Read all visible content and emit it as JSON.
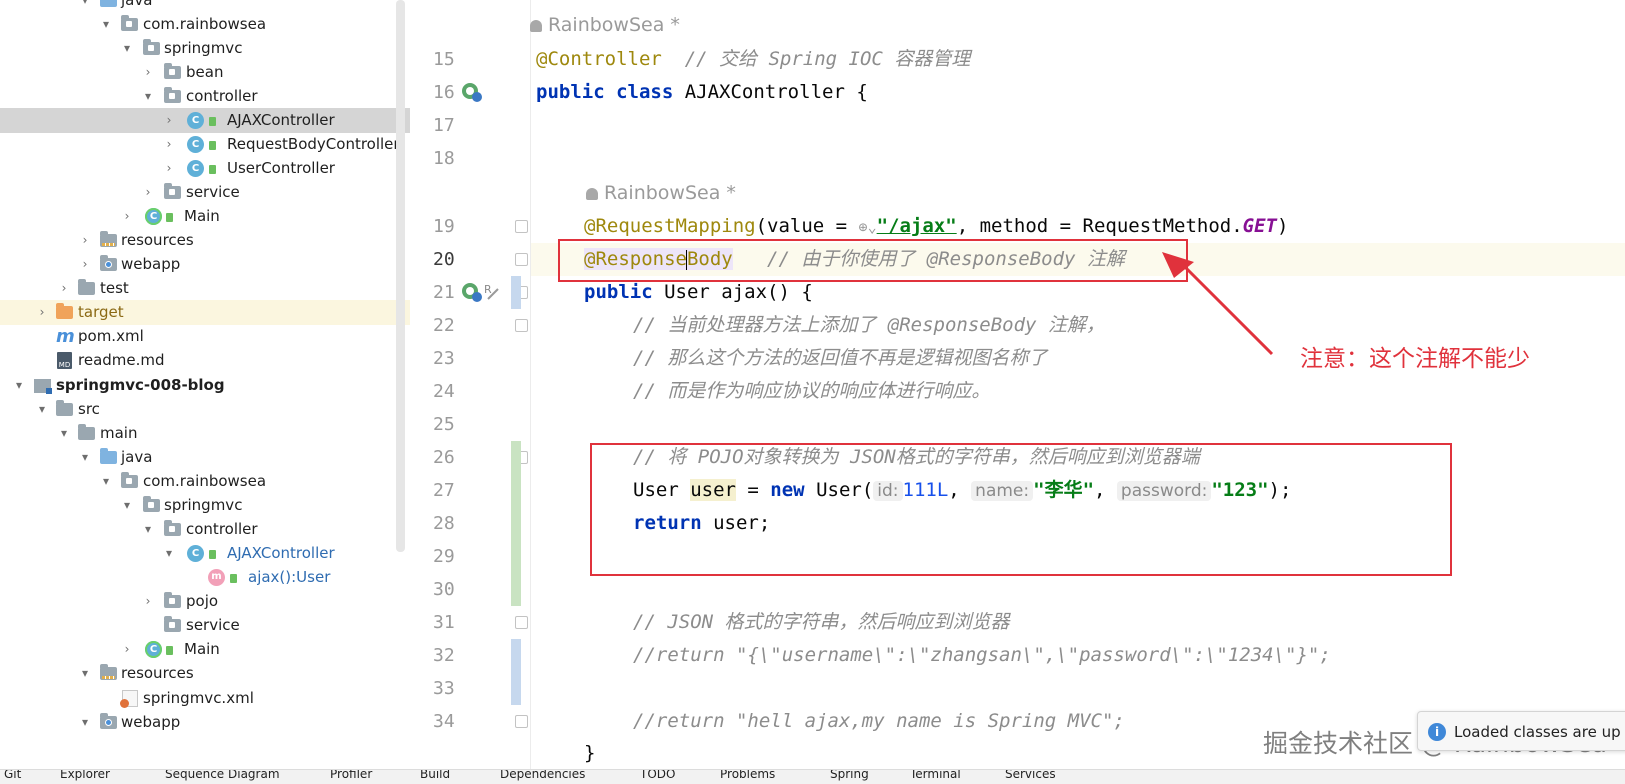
{
  "tree": {
    "items": [
      {
        "label": "java"
      },
      {
        "label": "com.rainbowsea"
      },
      {
        "label": "springmvc"
      },
      {
        "label": "bean"
      },
      {
        "label": "controller"
      },
      {
        "label": "AJAXController"
      },
      {
        "label": "RequestBodyController"
      },
      {
        "label": "UserController"
      },
      {
        "label": "service"
      },
      {
        "label": "Main"
      },
      {
        "label": "resources"
      },
      {
        "label": "webapp"
      },
      {
        "label": "test"
      },
      {
        "label": "target"
      },
      {
        "label": "pom.xml"
      },
      {
        "label": "readme.md"
      },
      {
        "label": "springmvc-008-blog"
      },
      {
        "label": "src"
      },
      {
        "label": "main"
      },
      {
        "label": "java"
      },
      {
        "label": "com.rainbowsea"
      },
      {
        "label": "springmvc"
      },
      {
        "label": "controller"
      },
      {
        "label": "AJAXController"
      },
      {
        "label": "ajax():User"
      },
      {
        "label": "pojo"
      },
      {
        "label": "service"
      },
      {
        "label": "Main"
      },
      {
        "label": "resources"
      },
      {
        "label": "springmvc.xml"
      },
      {
        "label": "webapp"
      }
    ]
  },
  "editor": {
    "author_1": "RainbowSea *",
    "author_2": "RainbowSea *",
    "line_numbers": [
      "15",
      "16",
      "17",
      "18",
      "19",
      "20",
      "21",
      "22",
      "23",
      "24",
      "25",
      "26",
      "27",
      "28",
      "29",
      "30",
      "31",
      "32",
      "33",
      "34"
    ],
    "l15": {
      "ann": "@Controller",
      "cmt": "  // 交给 Spring IOC 容器管理"
    },
    "l16": {
      "kw1": "public",
      "kw2": "class",
      "rest": " AJAXController {"
    },
    "l19": {
      "ann": "@RequestMapping",
      "p1": "(value = ",
      "str": "\"/ajax\"",
      "p2": ", method = RequestMethod.",
      "fld": "GET",
      "p3": ")"
    },
    "l20": {
      "ann_a": "@Response",
      "ann_b": "Body",
      "cmt": "   // 由于你使用了 @ResponseBody 注解"
    },
    "l21": {
      "kw": "public",
      "rest": " User ajax() {"
    },
    "l22": "// 当前处理器方法上添加了 @ResponseBody 注解，",
    "l23": "// 那么这个方法的返回值不再是逻辑视图名称了",
    "l24": "// 而是作为响应协议的响应体进行响应。",
    "l26": "// 将 POJO对象转换为 JSON格式的字符串，然后响应到浏览器端",
    "l27": {
      "t1": "User ",
      "var": "user",
      "t2": " = ",
      "kw": "new",
      "t3": " User(",
      "h1": "id:",
      "num": "111L",
      "t4": ", ",
      "h2": "name:",
      "s1": "\"李华\"",
      "t5": ", ",
      "h3": "password:",
      "s2": "\"123\"",
      "t6": ");"
    },
    "l28": {
      "kw": "return",
      "rest": " user;"
    },
    "l31": "// JSON 格式的字符串，然后响应到浏览器",
    "l32": "//return \"{\\\"username\\\":\\\"zhangsan\\\",\\\"password\\\":\\\"1234\\\"}\";",
    "l34": "//return \"hell ajax,my name is Spring MVC\";",
    "l35": "}"
  },
  "annotation_note": "注意：这个注解不能少",
  "watermark": "掘金技术社区 @ RainbowSea",
  "toast": {
    "icon": "i",
    "text": "Loaded classes are up t"
  },
  "bottom_tabs": [
    "Git",
    "Explorer",
    "Sequence Diagram",
    "Profiler",
    "Build",
    "Dependencies",
    "TODO",
    "Problems",
    "Spring",
    "Terminal",
    "Services"
  ],
  "colors": {
    "accent_red": "#e0323c",
    "keyword": "#0033b3",
    "annotation": "#9e880d",
    "string": "#067d17",
    "comment": "#8c8c8c"
  }
}
